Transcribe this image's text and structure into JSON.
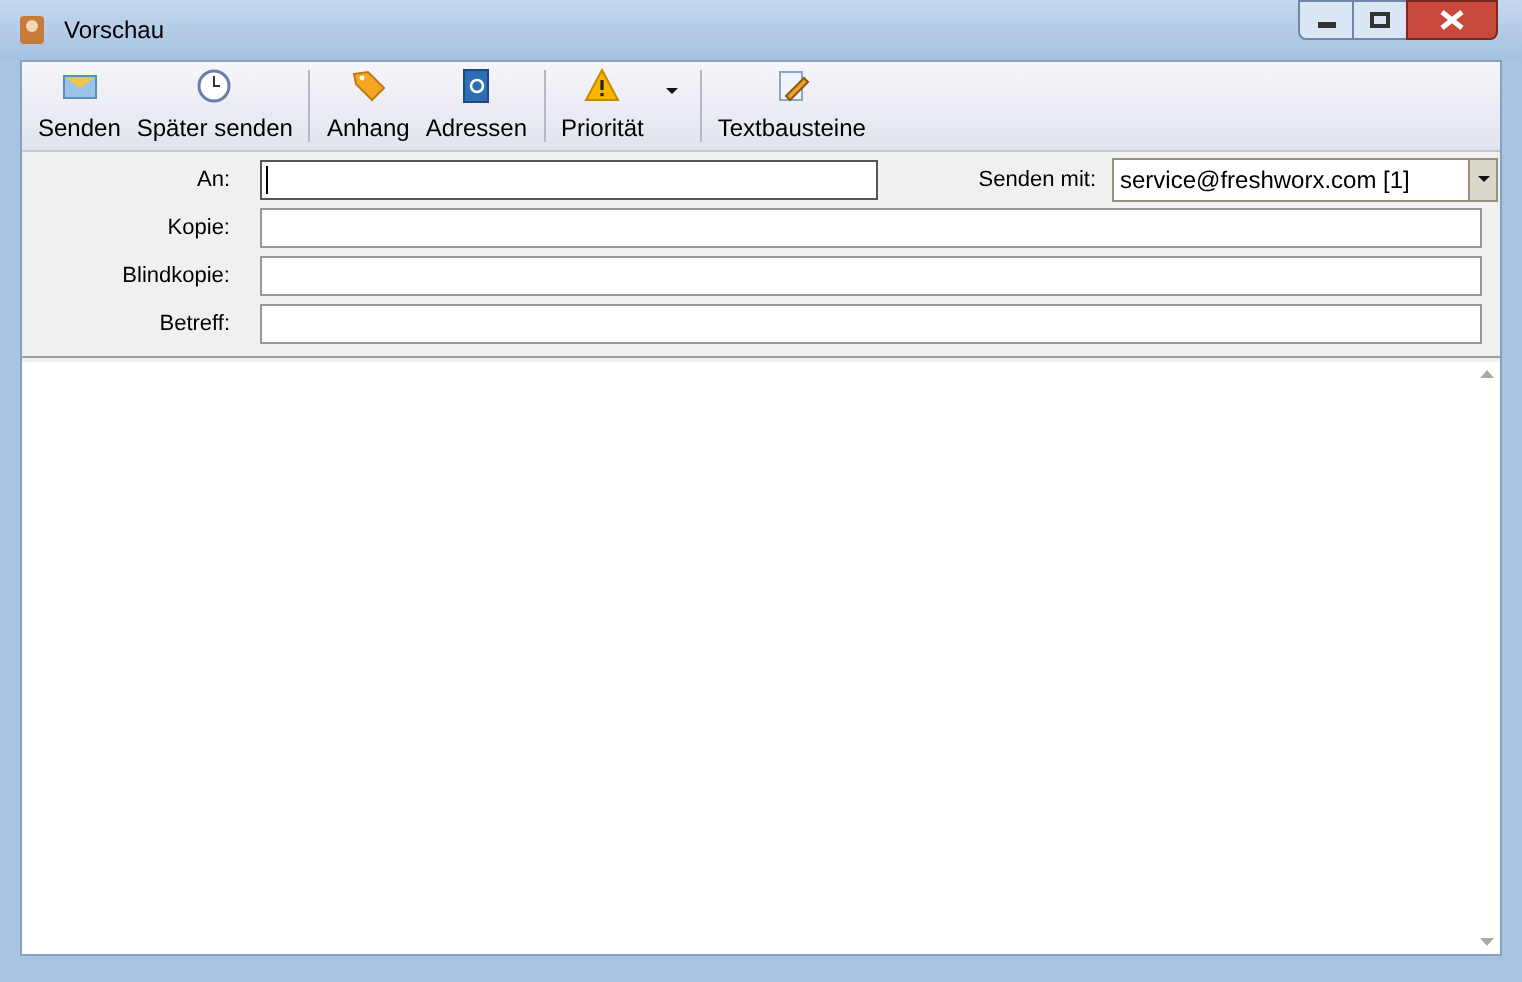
{
  "window": {
    "title": "Vorschau"
  },
  "toolbar": {
    "groups": [
      [
        {
          "label": "Senden",
          "kind": "envelope",
          "has_menu": false
        },
        {
          "label": "Später senden",
          "kind": "clock",
          "has_menu": false
        }
      ],
      [
        {
          "label": "Anhang",
          "kind": "tag",
          "has_menu": false
        },
        {
          "label": "Adressen",
          "kind": "book",
          "has_menu": false
        }
      ],
      [
        {
          "label": "Priorität",
          "kind": "warning",
          "has_menu": true
        }
      ],
      [
        {
          "label": "Textbausteine",
          "kind": "note",
          "has_menu": false
        }
      ]
    ]
  },
  "fields": [
    {
      "label": "An:",
      "focused": true
    },
    {
      "label": "Kopie:",
      "focused": false
    },
    {
      "label": "Blindkopie:",
      "focused": false
    },
    {
      "label": "Betreff:",
      "focused": false
    }
  ],
  "sender": {
    "label": "Senden mit:",
    "value": "service@freshworx.com [1]"
  }
}
